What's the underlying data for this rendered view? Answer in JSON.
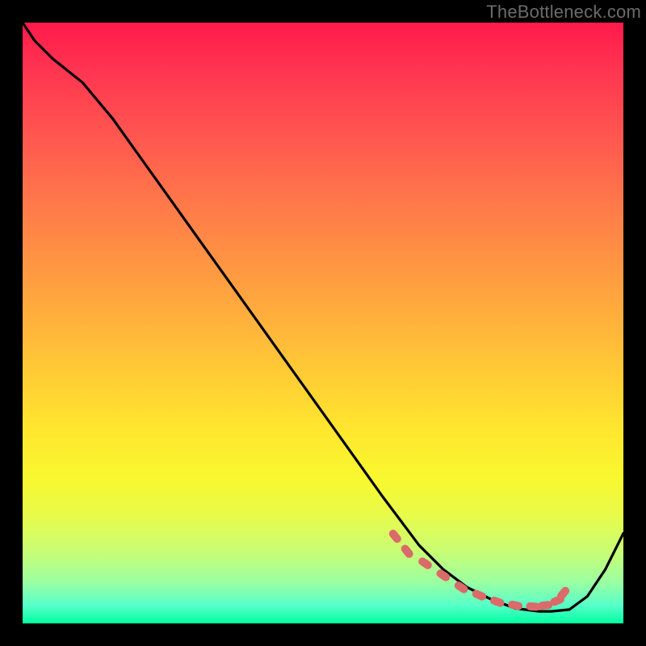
{
  "watermark": "TheBottleneck.com",
  "chart_data": {
    "type": "line",
    "title": "",
    "xlabel": "",
    "ylabel": "",
    "xlim": [
      0,
      100
    ],
    "ylim": [
      0,
      100
    ],
    "background_gradient_top": "#ff1a4a",
    "background_gradient_bottom": "#00ffa2",
    "series": [
      {
        "name": "curve",
        "color": "#000000",
        "x": [
          0,
          2,
          5,
          10,
          15,
          20,
          25,
          30,
          35,
          40,
          45,
          50,
          55,
          60,
          63,
          66,
          70,
          74,
          78,
          82,
          86,
          88,
          91,
          94,
          97,
          100
        ],
        "y": [
          100,
          97,
          94,
          90,
          84,
          77,
          70,
          63,
          56,
          49,
          42,
          35,
          28,
          21,
          17,
          13,
          9,
          6,
          4,
          2.5,
          2.0,
          2.0,
          2.3,
          4.5,
          9,
          15
        ]
      },
      {
        "name": "markers",
        "color": "#db6a6a",
        "type": "scatter",
        "x": [
          62,
          64,
          67,
          70,
          73,
          76,
          79,
          82,
          85,
          87,
          89,
          90
        ],
        "y": [
          14.5,
          12,
          10,
          8,
          6,
          4.7,
          3.6,
          3.0,
          2.8,
          3.0,
          3.8,
          5.0
        ]
      }
    ]
  }
}
